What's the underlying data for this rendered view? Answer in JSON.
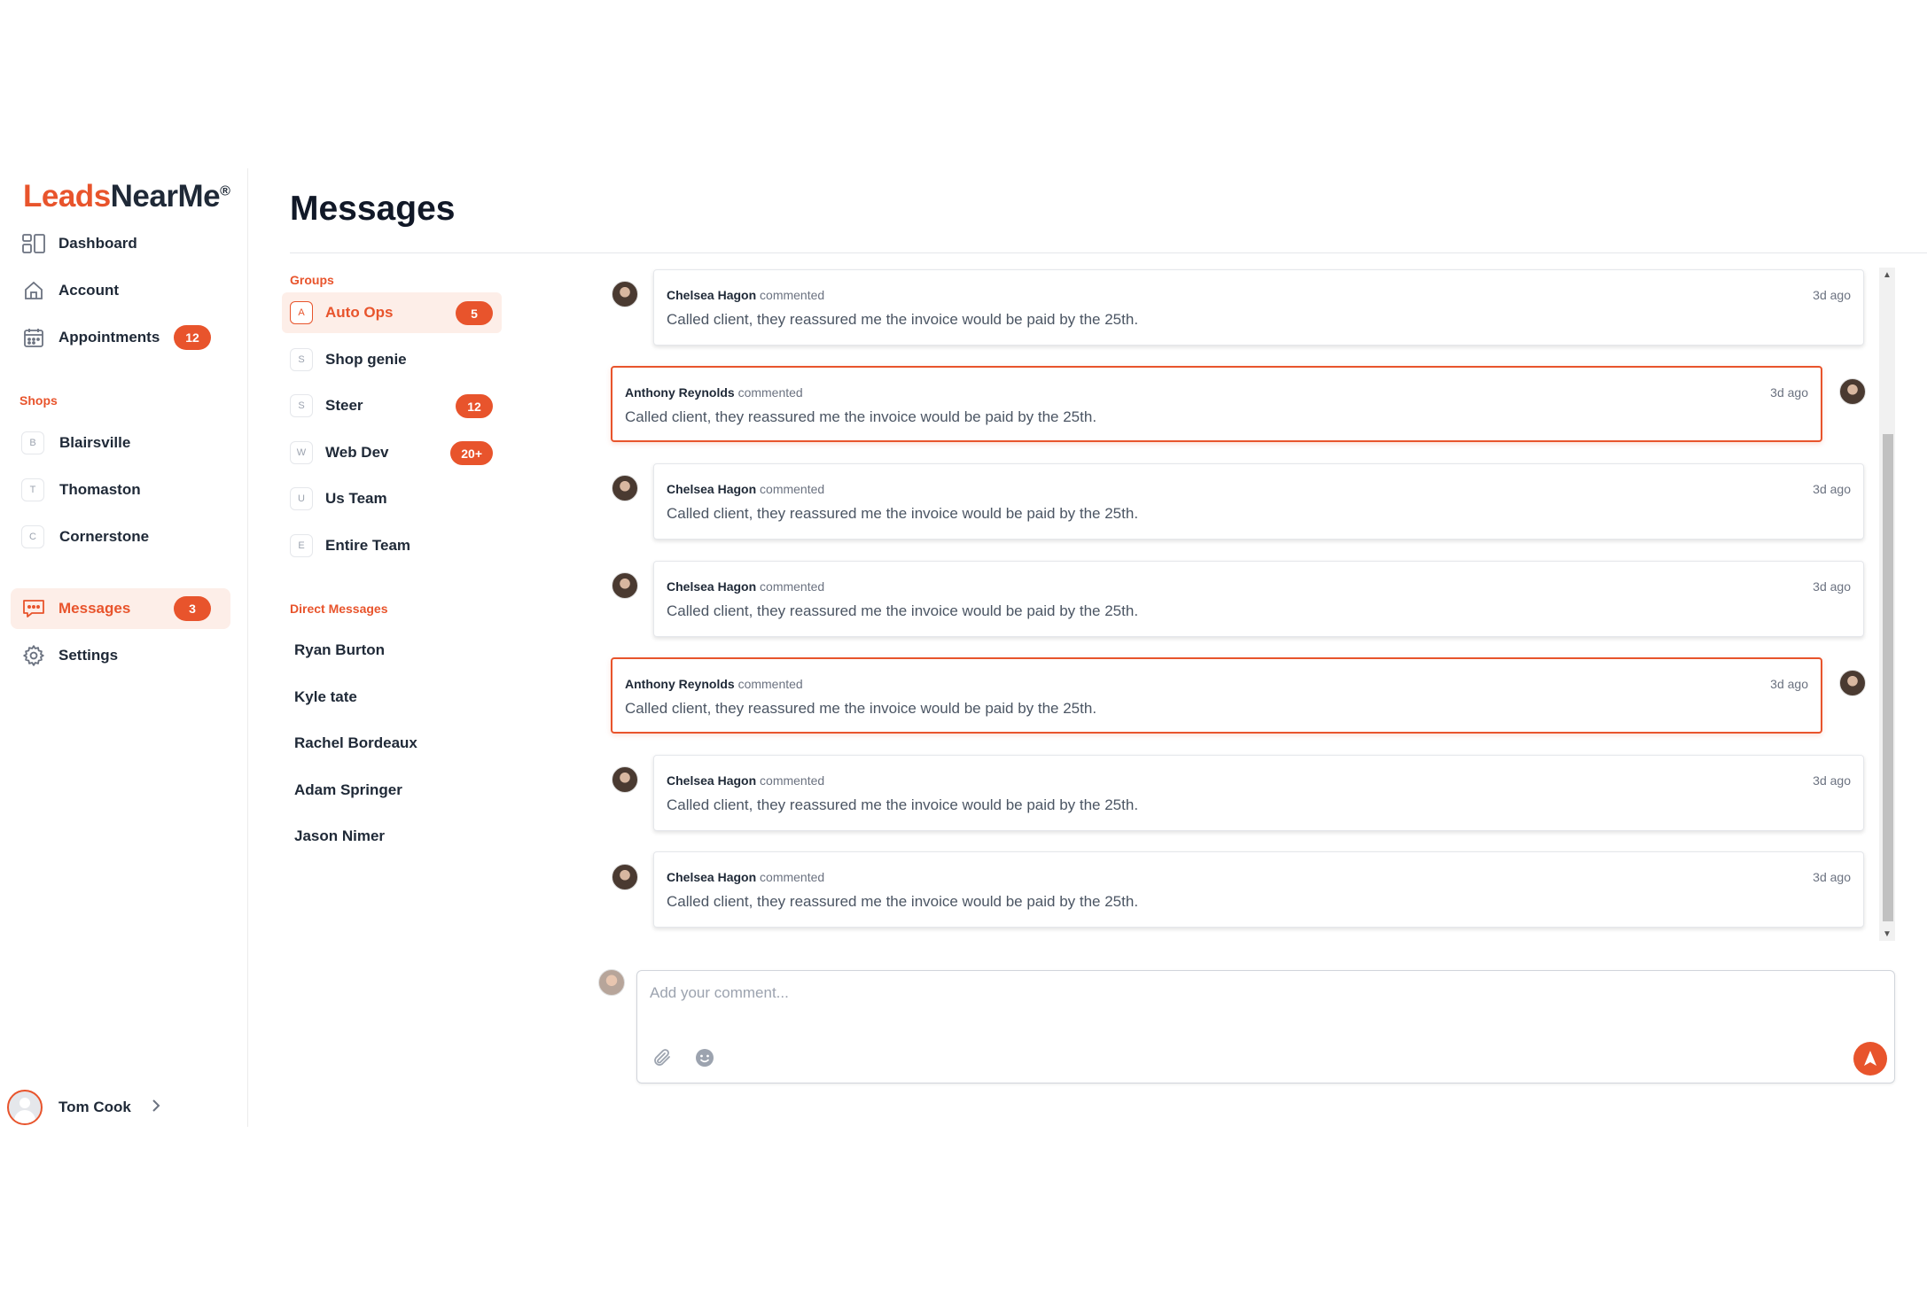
{
  "brand": {
    "part1": "Leads",
    "part2": "NearMe",
    "reg": "®"
  },
  "nav": {
    "dashboard": "Dashboard",
    "account": "Account",
    "appointments": "Appointments",
    "appointments_badge": "12",
    "messages": "Messages",
    "messages_badge": "3",
    "settings": "Settings"
  },
  "shops": {
    "label": "Shops",
    "items": [
      {
        "initial": "B",
        "name": "Blairsville"
      },
      {
        "initial": "T",
        "name": "Thomaston"
      },
      {
        "initial": "C",
        "name": "Cornerstone"
      }
    ]
  },
  "user": {
    "name": "Tom Cook"
  },
  "page": {
    "title": "Messages"
  },
  "groups": {
    "label": "Groups",
    "items": [
      {
        "initial": "A",
        "name": "Auto Ops",
        "badge": "5"
      },
      {
        "initial": "S",
        "name": "Shop genie",
        "badge": ""
      },
      {
        "initial": "S",
        "name": "Steer",
        "badge": "12"
      },
      {
        "initial": "W",
        "name": "Web Dev",
        "badge": "20+"
      },
      {
        "initial": "U",
        "name": "Us Team",
        "badge": ""
      },
      {
        "initial": "E",
        "name": "Entire Team",
        "badge": ""
      }
    ]
  },
  "direct_messages": {
    "label": "Direct Messages",
    "items": [
      "Ryan Burton",
      "Kyle tate",
      "Rachel Bordeaux",
      "Adam Springer",
      "Jason Nimer"
    ]
  },
  "messages": [
    {
      "author": "Chelsea Hagon",
      "action": "commented",
      "time": "3d ago",
      "text": "Called client, they reassured me the invoice would be paid by the 25th.",
      "self": false
    },
    {
      "author": "Anthony Reynolds",
      "action": "commented",
      "time": "3d ago",
      "text": "Called client, they reassured me the invoice would be paid by the 25th.",
      "self": true
    },
    {
      "author": "Chelsea Hagon",
      "action": "commented",
      "time": "3d ago",
      "text": "Called client, they reassured me the invoice would be paid by the 25th.",
      "self": false
    },
    {
      "author": "Chelsea Hagon",
      "action": "commented",
      "time": "3d ago",
      "text": "Called client, they reassured me the invoice would be paid by the 25th.",
      "self": false
    },
    {
      "author": "Anthony Reynolds",
      "action": "commented",
      "time": "3d ago",
      "text": "Called client, they reassured me the invoice would be paid by the 25th.",
      "self": true
    },
    {
      "author": "Chelsea Hagon",
      "action": "commented",
      "time": "3d ago",
      "text": "Called client, they reassured me the invoice would be paid by the 25th.",
      "self": false
    },
    {
      "author": "Chelsea Hagon",
      "action": "commented",
      "time": "3d ago",
      "text": "Called client, they reassured me the invoice would be paid by the 25th.",
      "self": false
    }
  ],
  "composer": {
    "placeholder": "Add your comment..."
  },
  "colors": {
    "accent": "#e8542c",
    "accent_light": "#fdeee8"
  },
  "icons": [
    "dashboard-icon",
    "home-icon",
    "calendar-icon",
    "chat-icon",
    "gear-icon",
    "paperclip-icon",
    "smiley-icon",
    "send-icon",
    "chevron-right-icon"
  ]
}
